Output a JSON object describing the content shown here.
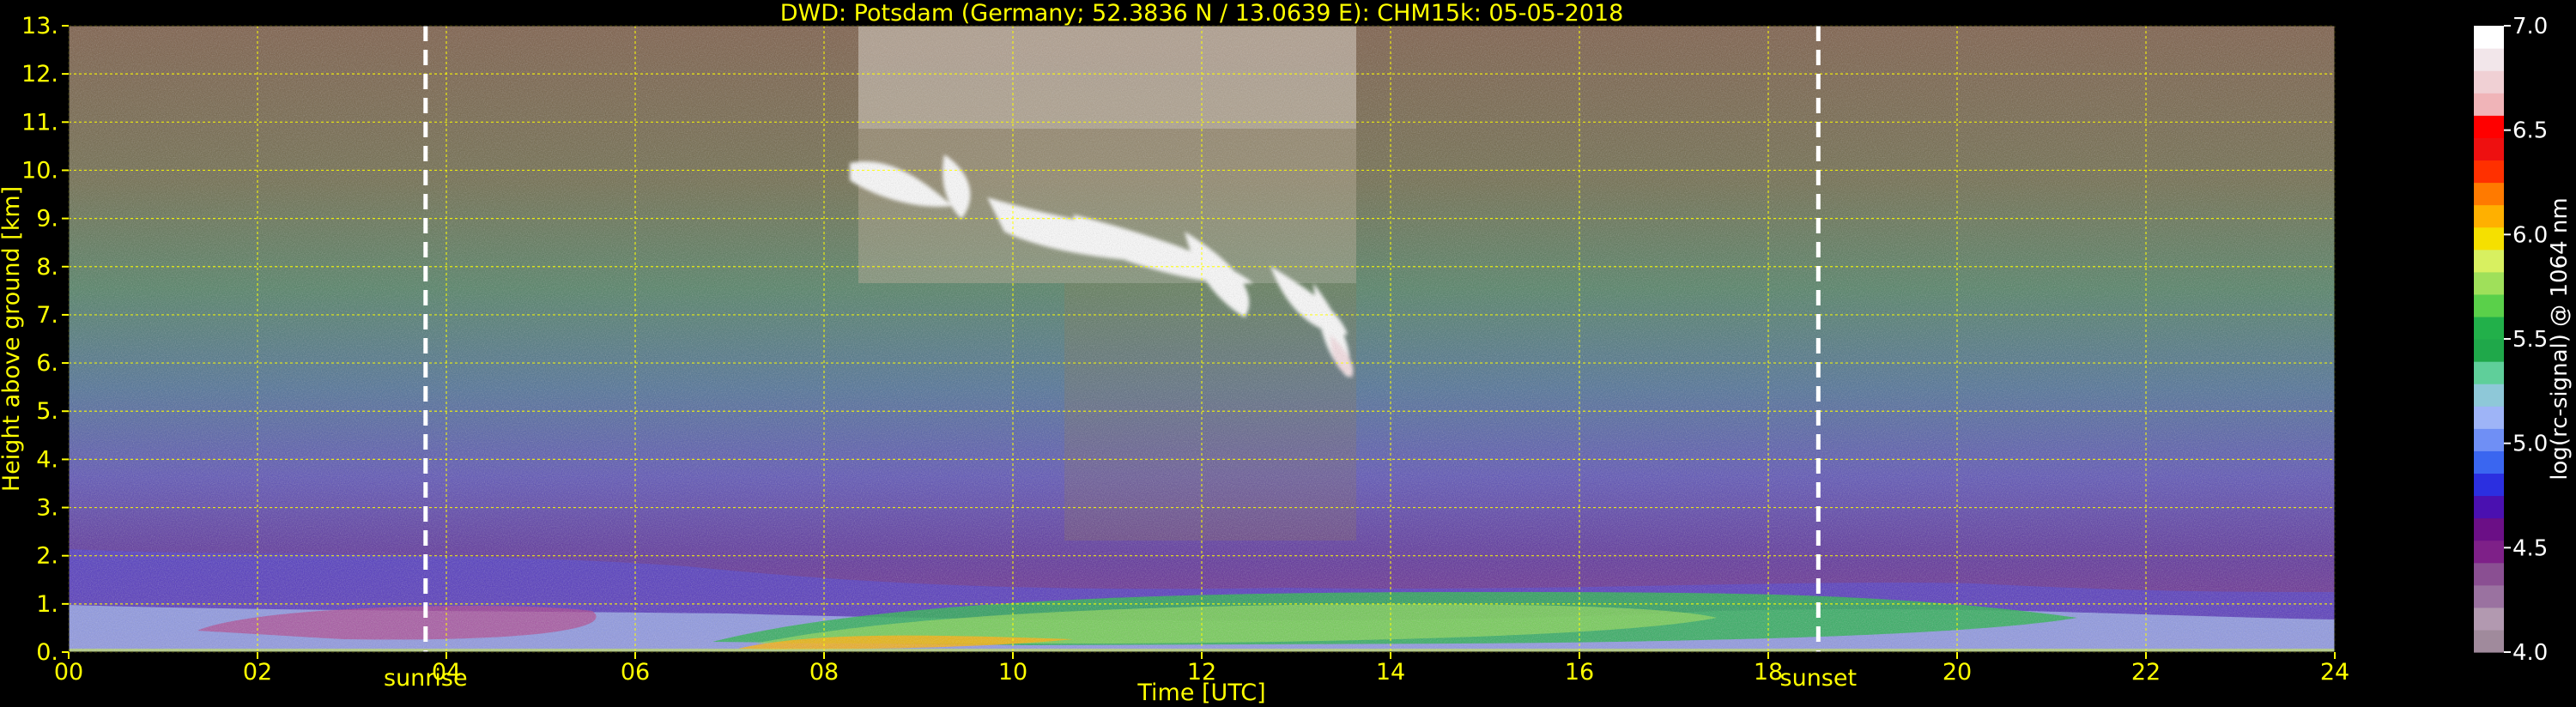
{
  "chart_data": {
    "type": "heatmap",
    "title": "DWD: Potsdam (Germany; 52.3836 N / 13.0639 E):    CHM15k: 05-05-2018",
    "xlabel": "Time [UTC]",
    "ylabel": "Height above ground [km]",
    "xlim": [
      0,
      24
    ],
    "ylim": [
      0,
      13
    ],
    "x_ticks": [
      "00",
      "02",
      "04",
      "06",
      "08",
      "10",
      "12",
      "14",
      "16",
      "18",
      "20",
      "22",
      "24"
    ],
    "y_ticks": [
      "0.",
      "1.",
      "2.",
      "3.",
      "4.",
      "5.",
      "6.",
      "7.",
      "8.",
      "9.",
      "10.",
      "11.",
      "12.",
      "13."
    ],
    "grid": true,
    "grid_color": "#ffff00",
    "colorbar": {
      "label": "log(rc-signal) @ 1064 nm",
      "range": [
        4.0,
        7.0
      ],
      "ticks": [
        "4.0",
        "4.5",
        "5.0",
        "5.5",
        "6.0",
        "6.5",
        "7.0"
      ],
      "colors": [
        "#a08a9c",
        "#b299b0",
        "#9a72a0",
        "#8a4f92",
        "#7e2088",
        "#6b0f86",
        "#4a10b0",
        "#2b2fe0",
        "#3a66f0",
        "#6f8ff5",
        "#9eb4f7",
        "#8ec8d8",
        "#5fcf9a",
        "#1fa84a",
        "#22b04a",
        "#5ad04a",
        "#9fe05a",
        "#d8f060",
        "#f5e000",
        "#ffb000",
        "#ff7a00",
        "#ff3000",
        "#ee1010",
        "#ff0000",
        "#f0b4b8",
        "#f0d0d4",
        "#f2e6ea",
        "#ffffff"
      ]
    },
    "annotations": [
      {
        "label": "sunrise",
        "x": 3.78
      },
      {
        "label": "sunset",
        "x": 18.53
      }
    ],
    "features": [
      {
        "name": "boundary-layer-aerosol",
        "x_range": [
          0,
          24
        ],
        "height_range_km": [
          0.0,
          1.3
        ],
        "level": 5.5
      },
      {
        "name": "cirrus-cloud",
        "x_range": [
          8.3,
          13.5
        ],
        "height_range_km": [
          5.8,
          10.5
        ],
        "level": 7.0
      },
      {
        "name": "background-noise",
        "x_range": [
          0,
          24
        ],
        "height_range_km": [
          2.0,
          13.0
        ],
        "level": 5.0
      }
    ]
  }
}
